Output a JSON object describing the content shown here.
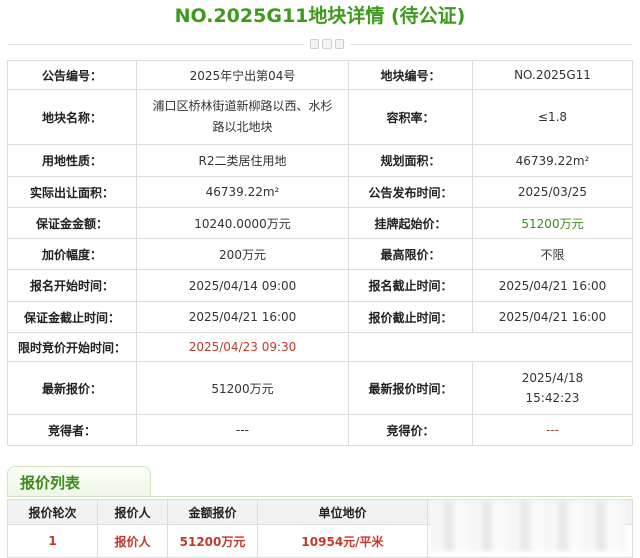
{
  "page": {
    "title": "NO.2025G11地块详情 (待公证)"
  },
  "detail": {
    "announcement_no_label": "公告编号：",
    "announcement_no": "2025年宁出第04号",
    "parcel_no_label": "地块编号：",
    "parcel_no": "NO.2025G11",
    "parcel_name_label": "地块名称：",
    "parcel_name": "浦口区桥林街道新柳路以西、水杉路以北地块",
    "far_label": "容积率：",
    "far": "≤1.8",
    "land_use_label": "用地性质：",
    "land_use": "R2二类居住用地",
    "planned_area_label": "规划面积：",
    "planned_area": "46739.22m²",
    "actual_area_label": "实际出让面积：",
    "actual_area": "46739.22m²",
    "publish_time_label": "公告发布时间：",
    "publish_time": "2025/03/25",
    "deposit_label": "保证金金额：",
    "deposit": "10240.0000万元",
    "start_price_label": "挂牌起始价：",
    "start_price": "51200万元",
    "increment_label": "加价幅度：",
    "increment": "200万元",
    "max_price_label": "最高限价：",
    "max_price": "不限",
    "reg_start_label": "报名开始时间：",
    "reg_start": "2025/04/14 09:00",
    "reg_end_label": "报名截止时间：",
    "reg_end": "2025/04/21 16:00",
    "deposit_end_label": "保证金截止时间：",
    "deposit_end": "2025/04/21 16:00",
    "bid_end_label": "报价截止时间：",
    "bid_end": "2025/04/21 16:00",
    "timed_start_label": "限时竞价开始时间：",
    "timed_start": "2025/04/23 09:30",
    "latest_bid_label": "最新报价：",
    "latest_bid": "51200万元",
    "latest_bid_time_label": "最新报价时间：",
    "latest_bid_time": "2025/4/18 15:42:23",
    "winner_label": "竞得者：",
    "winner": "---",
    "winning_price_label": "竞得价：",
    "winning_price": "---"
  },
  "bid_list": {
    "title": "报价列表",
    "headers": [
      "报价轮次",
      "报价人",
      "金额报价",
      "单位地价"
    ],
    "rows": [
      {
        "round": "1",
        "bidder": "报价人",
        "amount": "51200万元",
        "unit_price": "10954元/平米"
      }
    ]
  },
  "colors": {
    "title_green": "#3d9a1c",
    "value_green": "#3d8b1f",
    "value_red": "#c0392b"
  }
}
